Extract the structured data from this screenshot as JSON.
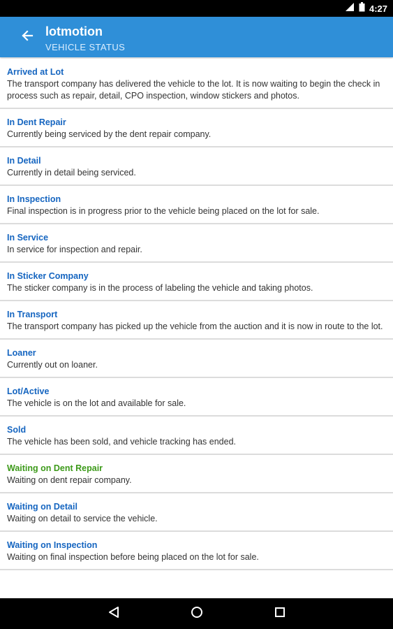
{
  "status_bar": {
    "time": "4:27",
    "icons": [
      "signal-icon",
      "battery-icon"
    ]
  },
  "app_bar": {
    "title": "lotmotion",
    "subtitle": "VEHICLE STATUS",
    "back_icon": "arrow-left-icon",
    "color": "#2f8fd8"
  },
  "statuses": [
    {
      "title": "Arrived at Lot",
      "description": "The transport company has delivered the vehicle to the lot. It is now waiting to begin the check in process such as repair, detail, CPO inspection, window stickers and photos."
    },
    {
      "title": "In Dent Repair",
      "description": "Currently being serviced by the dent repair company."
    },
    {
      "title": "In Detail",
      "description": "Currently in detail being serviced."
    },
    {
      "title": "In Inspection",
      "description": "Final inspection is in progress prior to the vehicle being placed on the lot for sale."
    },
    {
      "title": "In Service",
      "description": "In service for inspection and repair."
    },
    {
      "title": "In Sticker Company",
      "description": "The sticker company is in the process of labeling the vehicle and taking photos."
    },
    {
      "title": "In Transport",
      "description": "The transport company has picked up the vehicle from the auction and it is now in route to the lot."
    },
    {
      "title": "Loaner",
      "description": "Currently out on loaner."
    },
    {
      "title": "Lot/Active",
      "description": "The vehicle is on the lot and available for sale."
    },
    {
      "title": "Sold",
      "description": "The vehicle has been sold, and vehicle tracking has ended."
    },
    {
      "title": "Waiting on Dent Repair",
      "description": "Waiting on dent repair company.",
      "title_color": "#3d9a1a"
    },
    {
      "title": "Waiting on Detail",
      "description": "Waiting on detail to service the vehicle."
    },
    {
      "title": "Waiting on Inspection",
      "description": "Waiting on final inspection before being placed on the lot for sale."
    }
  ],
  "nav_bar": {
    "icons": [
      "back-triangle-icon",
      "home-circle-icon",
      "recents-square-icon"
    ]
  }
}
